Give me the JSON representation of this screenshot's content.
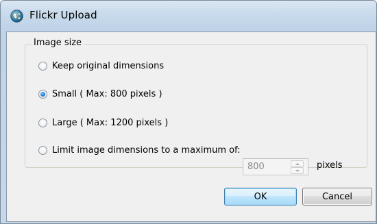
{
  "window": {
    "title": "Flickr Upload",
    "icon": "globe-icon"
  },
  "image_size_group": {
    "label": "Image size",
    "options": [
      {
        "label": "Keep original dimensions",
        "checked": false
      },
      {
        "label": "Small ( Max: 800 pixels )",
        "checked": true
      },
      {
        "label": "Large ( Max: 1200 pixels )",
        "checked": false
      },
      {
        "label": "Limit image dimensions to a maximum of:",
        "checked": false
      }
    ],
    "max_dimension": {
      "value": "800",
      "units": "pixels",
      "enabled": false
    }
  },
  "buttons": {
    "ok_label": "OK",
    "cancel_label": "Cancel"
  },
  "colors": {
    "title_bar": "#c9dbec",
    "dialog_background": "#f0f0f0",
    "default_button_border": "#3c7fb1",
    "radio_selected": "#2a7ee0"
  }
}
